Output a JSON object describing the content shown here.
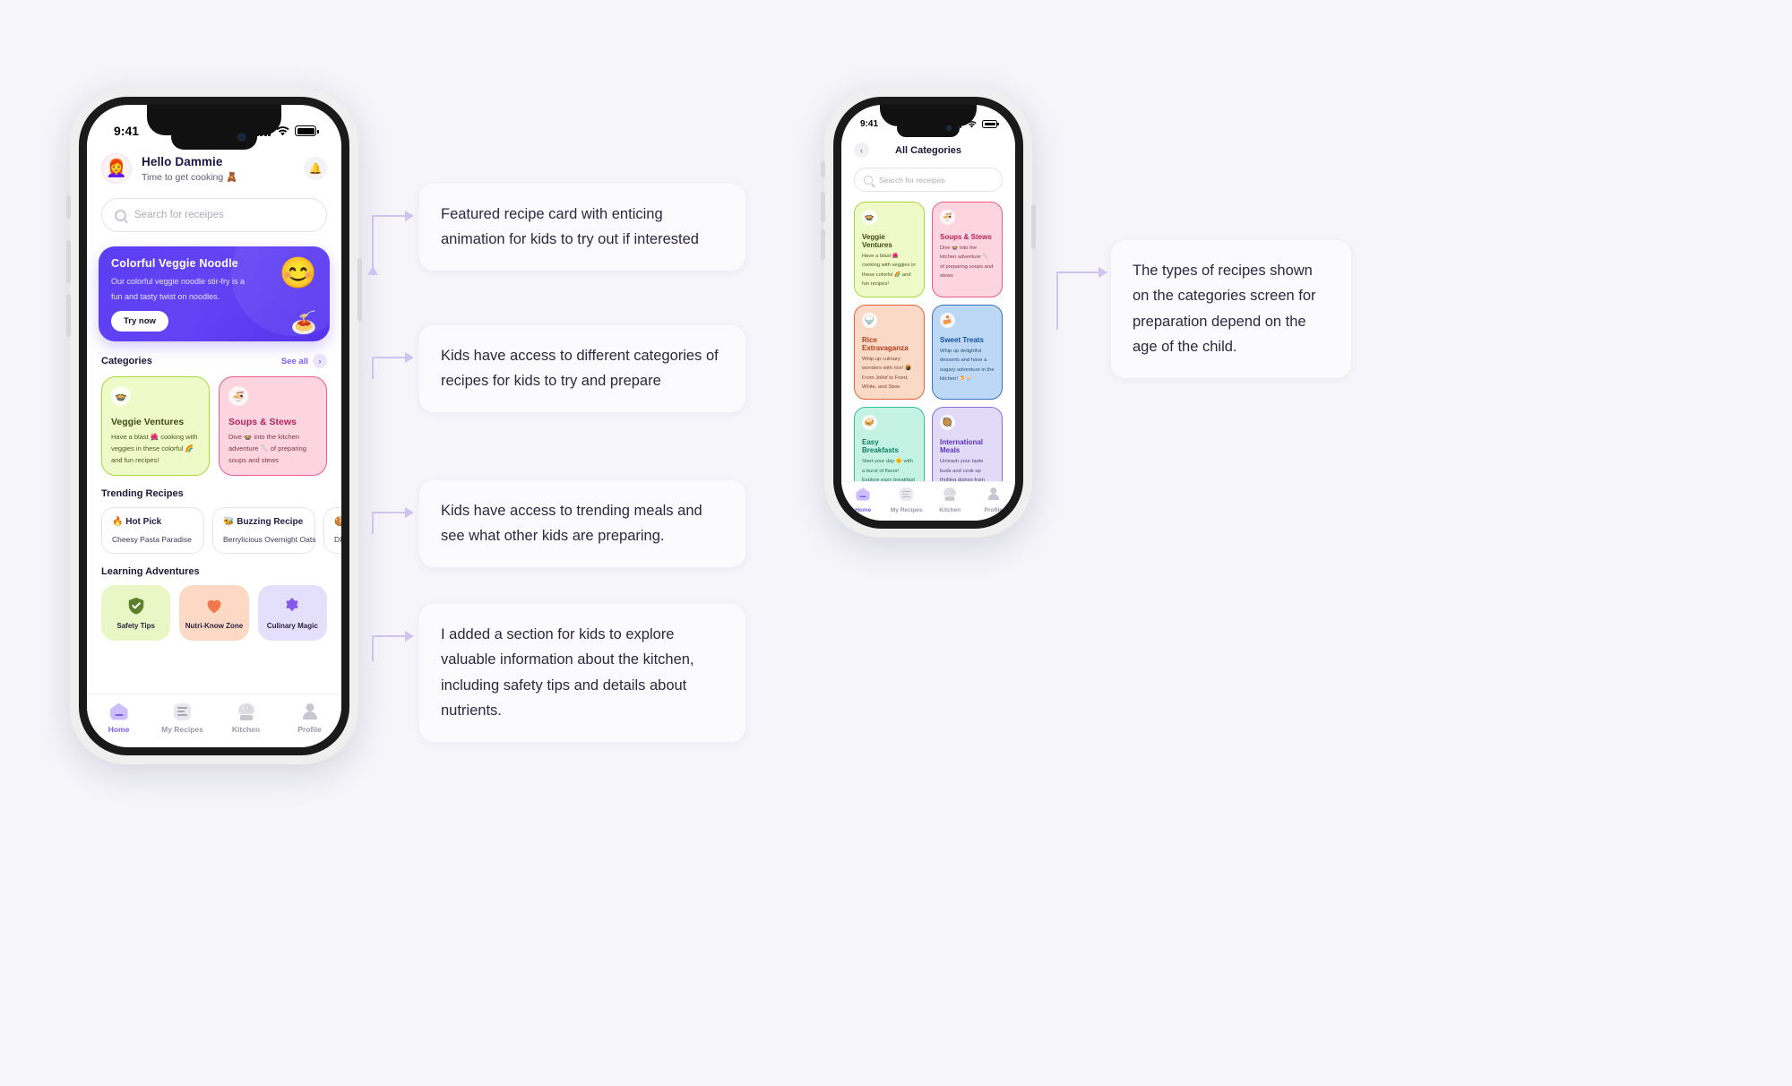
{
  "phone1": {
    "status": {
      "time": "9:41"
    },
    "header": {
      "avatar_emoji": "👩‍🦰",
      "greeting": "Hello Dammie",
      "subtitle": "Time to get cooking 🧸",
      "bell_icon": "bell-icon"
    },
    "search": {
      "placeholder": "Search for receipes",
      "icon": "search-icon"
    },
    "hero": {
      "title": "Colorful Veggie Noodle",
      "description": "Our colorful veggie noodle stir-fry is a fun and tasty twist on noodles.",
      "button": "Try now",
      "emoji": "😊",
      "emoji2": "🍝",
      "bg_color": "#5b3ef0"
    },
    "categories_section": {
      "title": "Categories",
      "see_all": "See all",
      "chevron": "›",
      "cards": [
        {
          "icon": "🍲",
          "name": "Veggie Ventures",
          "desc": "Have a blast 🌺 cooking with veggies in these colorful 🌈 and fun recipes!",
          "bg": "#eefbc9",
          "border": "#a8d93c",
          "title_color": "#3f4a12",
          "text_color": "#4d5720"
        },
        {
          "icon": "🍜",
          "name": "Soups & Stews",
          "desc": "Dive 🍲 into the kitchen adventure 🥄 of preparing soups and stews",
          "bg": "#fcd5e0",
          "border": "#e85d8a",
          "title_color": "#b3245a",
          "text_color": "#7d3550"
        }
      ]
    },
    "trending_section": {
      "title": "Trending Recipes",
      "cards": [
        {
          "title": "🔥 Hot Pick",
          "sub": "Cheesy Pasta Paradise"
        },
        {
          "title": "🐝 Buzzing Recipe",
          "sub": "Berrylicious Overnight Oats"
        },
        {
          "title": "🍪 C",
          "sub": "DIY P"
        }
      ]
    },
    "learning_section": {
      "title": "Learning Adventures",
      "cards": [
        {
          "label": "Safety Tips",
          "bg": "#e8f7c5",
          "shape": "shield-icon",
          "shape_color": "#5d7f2a"
        },
        {
          "label": "Nutri-Know Zone",
          "bg": "#fbd9c5",
          "shape": "heart-icon",
          "shape_color": "#f0794c"
        },
        {
          "label": "Culinary Magic",
          "bg": "#e4dffb",
          "shape": "star-icon",
          "shape_color": "#8559e8"
        }
      ]
    },
    "tabbar": [
      {
        "label": "Home",
        "icon": "home-icon",
        "active": true
      },
      {
        "label": "My Recipes",
        "icon": "list-icon",
        "active": false
      },
      {
        "label": "Kitchen",
        "icon": "chef-hat-icon",
        "active": false
      },
      {
        "label": "Profile",
        "icon": "user-icon",
        "active": false
      }
    ]
  },
  "phone2": {
    "status": {
      "time": "9:41"
    },
    "nav": {
      "back_icon": "chevron-left-icon",
      "title": "All Categories"
    },
    "search": {
      "placeholder": "Search for receipes",
      "icon": "search-icon"
    },
    "grid": [
      {
        "icon": "🍲",
        "name": "Veggie Ventures",
        "desc": "Have a blast 🌺 cooking with veggies in these colorful 🌈 and fun recipes!",
        "bg": "#eefbc9",
        "border": "#a8d93c",
        "title_color": "#3f4a12",
        "text_color": "#4d5720"
      },
      {
        "icon": "🍜",
        "name": "Soups & Stews",
        "desc": "Dive 🍲 into the kitchen adventure 🥄 of preparing soups and stews",
        "bg": "#fcd5e0",
        "border": "#e85d8a",
        "title_color": "#b3245a",
        "text_color": "#7d3550"
      },
      {
        "icon": "🍚",
        "name": "Rice Extravaganza",
        "desc": "Whip up culinary wonders with rice! 🍘 From Jollof to Fried, White, and Stew",
        "bg": "#fbd9c7",
        "border": "#e2653c",
        "title_color": "#b33d18",
        "text_color": "#7e4730"
      },
      {
        "icon": "🍰",
        "name": "Sweet Treats",
        "desc": "Whip up delightful desserts and have a sugary adventure in the kitchen! 🍮🧁",
        "bg": "#bcd8f5",
        "border": "#3b72c4",
        "title_color": "#16509e",
        "text_color": "#2d4f78"
      },
      {
        "icon": "🥪",
        "name": "Easy Breakfasts",
        "desc": "Start your day 🌞 with a burst of flavor! Explore easy breakfast recipes 🍳",
        "bg": "#c4f3e3",
        "border": "#2fbf9a",
        "title_color": "#0e7c63",
        "text_color": "#2c6b5c"
      },
      {
        "icon": "🥘",
        "name": "International Meals",
        "desc": "Unleash your taste buds and cook up thrilling dishes from around the world. 🌍🍽",
        "bg": "#e2dbf8",
        "border": "#8b6fd9",
        "title_color": "#5a33bf",
        "text_color": "#524474"
      }
    ],
    "tabbar": [
      {
        "label": "Home",
        "icon": "home-icon",
        "active": true
      },
      {
        "label": "My Recipes",
        "icon": "list-icon",
        "active": false
      },
      {
        "label": "Kitchen",
        "icon": "chef-hat-icon",
        "active": false
      },
      {
        "label": "Profile",
        "icon": "user-icon",
        "active": false
      }
    ]
  },
  "annotations": [
    {
      "text": "Featured recipe card with enticing animation for kids to try out if interested"
    },
    {
      "text": "Kids have access to different categories of recipes for kids to try and prepare"
    },
    {
      "text": "Kids have access to trending meals and see what other kids are preparing."
    },
    {
      "text": "I added a section for kids to explore valuable information about the kitchen, including safety tips and details about nutrients."
    },
    {
      "text": "The types of recipes shown on the categories screen for preparation depend on the age of the child."
    }
  ]
}
